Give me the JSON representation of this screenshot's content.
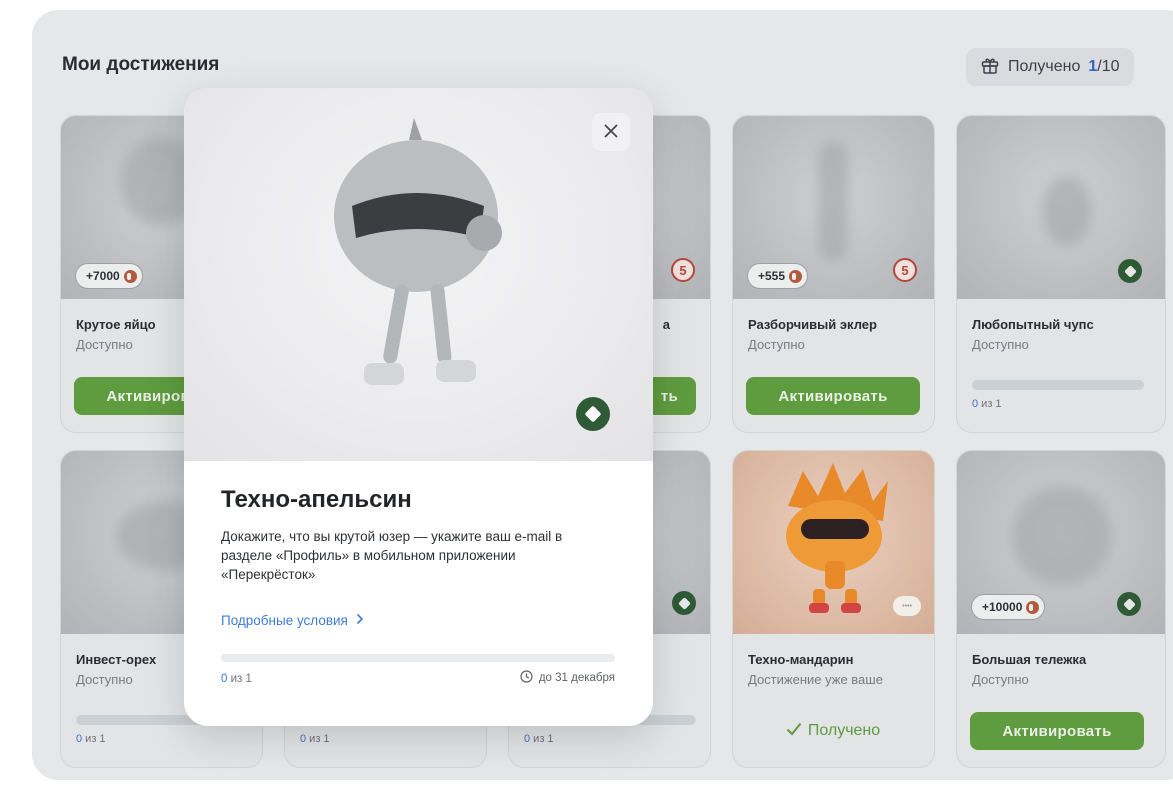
{
  "header": {
    "title": "Мои достижения",
    "counter_label": "Получено",
    "counter_done": "1",
    "counter_total": "/10"
  },
  "cards": [
    {
      "name": "Крутое яйцо",
      "status": "Доступно",
      "points": "+7000",
      "button": "Активировать"
    },
    {
      "name": "Разборчивый эклер",
      "status": "Доступно",
      "points": "+555",
      "button": "Активировать"
    },
    {
      "name": "Любопытный чупс",
      "status": "Доступно",
      "progress_current": "0",
      "progress_rest": " из 1"
    },
    {
      "name": "Инвест-орех",
      "status": "Доступно",
      "progress_current": "0",
      "progress_rest": " из 1"
    },
    {
      "progress_current": "0",
      "progress_rest": " из 1"
    },
    {
      "progress_current": "0",
      "progress_rest": " из 1"
    },
    {
      "name": "Техно-мандарин",
      "status": "Достижение уже ваше",
      "received": "Получено"
    },
    {
      "name": "Большая тележка",
      "status": "Доступно",
      "points": "+10000",
      "button": "Активировать"
    }
  ],
  "partial": {
    "row1_col3_name_tail": "a",
    "row1_col3_button_tail": "ть"
  },
  "modal": {
    "title": "Техно-апельсин",
    "description": "Докажите, что вы крутой юзер — укажите ваш e-mail в разделе «Профиль» в мобильном приложении «Перекрёсток»",
    "link": "Подробные условия",
    "progress_current": "0",
    "progress_rest": " из 1",
    "deadline": "до 31 декабря",
    "progress_fraction": 0
  },
  "colors": {
    "accent_green": "#5f9b3f",
    "link_blue": "#3e7bd9",
    "badge_green": "#2f5a36",
    "badge_red": "#b5473b"
  },
  "icons": {
    "counter": "gift-icon",
    "close": "close-icon",
    "deadline": "clock-icon",
    "link": "chevron-right-icon",
    "received": "checkmark-icon"
  }
}
